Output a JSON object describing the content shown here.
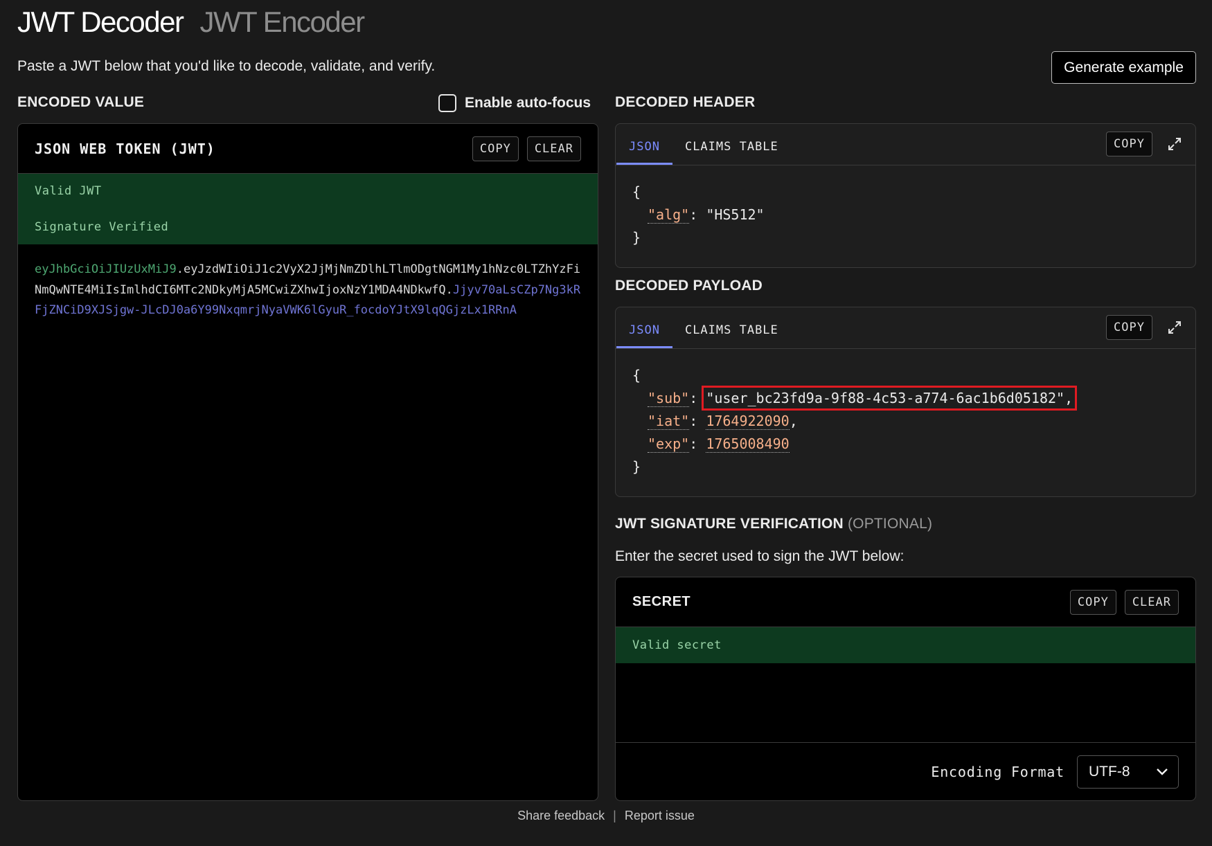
{
  "header": {
    "tabs": [
      {
        "label": "JWT Decoder",
        "active": true
      },
      {
        "label": "JWT Encoder",
        "active": false
      }
    ],
    "subtitle": "Paste a JWT below that you'd like to decode, validate, and verify.",
    "generate_button": "Generate example"
  },
  "encoded": {
    "section_label": "ENCODED VALUE",
    "autofocus_label": "Enable auto-focus",
    "autofocus_checked": false,
    "panel_title": "JSON WEB TOKEN (JWT)",
    "copy": "COPY",
    "clear": "CLEAR",
    "status_valid": "Valid JWT",
    "status_signature": "Signature Verified",
    "token_header": "eyJhbGciOiJIUzUxMiJ9",
    "token_payload": "eyJzdWIiOiJ1c2VyX2JjMjNmZDlhLTlmODgtNGM1My1hNzc0LTZhYzFiNmQwNTE4MiIsImlhdCI6MTc2NDkyMjA5MCwiZXhwIjoxNzY1MDA4NDkwfQ",
    "token_signature": "Jjyv70aLsCZp7Ng3kRFjZNCiD9XJSjgw-JLcDJ0a6Y99NxqmrjNyaVWK6lGyuR_focdoYJtX9lqQGjzLx1RRnA",
    "dot": "."
  },
  "decoded_header": {
    "section_label": "DECODED HEADER",
    "tab_json": "JSON",
    "tab_claims": "CLAIMS TABLE",
    "copy": "COPY",
    "open_brace": "{",
    "close_brace": "}",
    "alg_key": "\"alg\"",
    "alg_value": "\"HS512\""
  },
  "decoded_payload": {
    "section_label": "DECODED PAYLOAD",
    "tab_json": "JSON",
    "tab_claims": "CLAIMS TABLE",
    "copy": "COPY",
    "open_brace": "{",
    "close_brace": "}",
    "sub_key": "\"sub\"",
    "sub_value": "\"user_bc23fd9a-9f88-4c53-a774-6ac1b6d05182\",",
    "iat_key": "\"iat\"",
    "iat_value": "1764922090",
    "exp_key": "\"exp\"",
    "exp_value": "1765008490",
    "colon": ": ",
    "comma": ","
  },
  "signature": {
    "section_label": "JWT SIGNATURE VERIFICATION",
    "section_label_optional": "(OPTIONAL)",
    "description": "Enter the secret used to sign the JWT below:",
    "panel_title": "SECRET",
    "copy": "COPY",
    "clear": "CLEAR",
    "status": "Valid secret",
    "encoding_label": "Encoding Format",
    "encoding_value": "UTF-8"
  },
  "footer": {
    "feedback": "Share feedback",
    "separator": "|",
    "report": "Report issue"
  },
  "colors": {
    "background": "#1a1a1a",
    "valid_green_bg": "#0d3a1f",
    "accent_tab": "#7c8cff",
    "json_value": "#f7b08a",
    "highlight_box": "#e01b22"
  }
}
